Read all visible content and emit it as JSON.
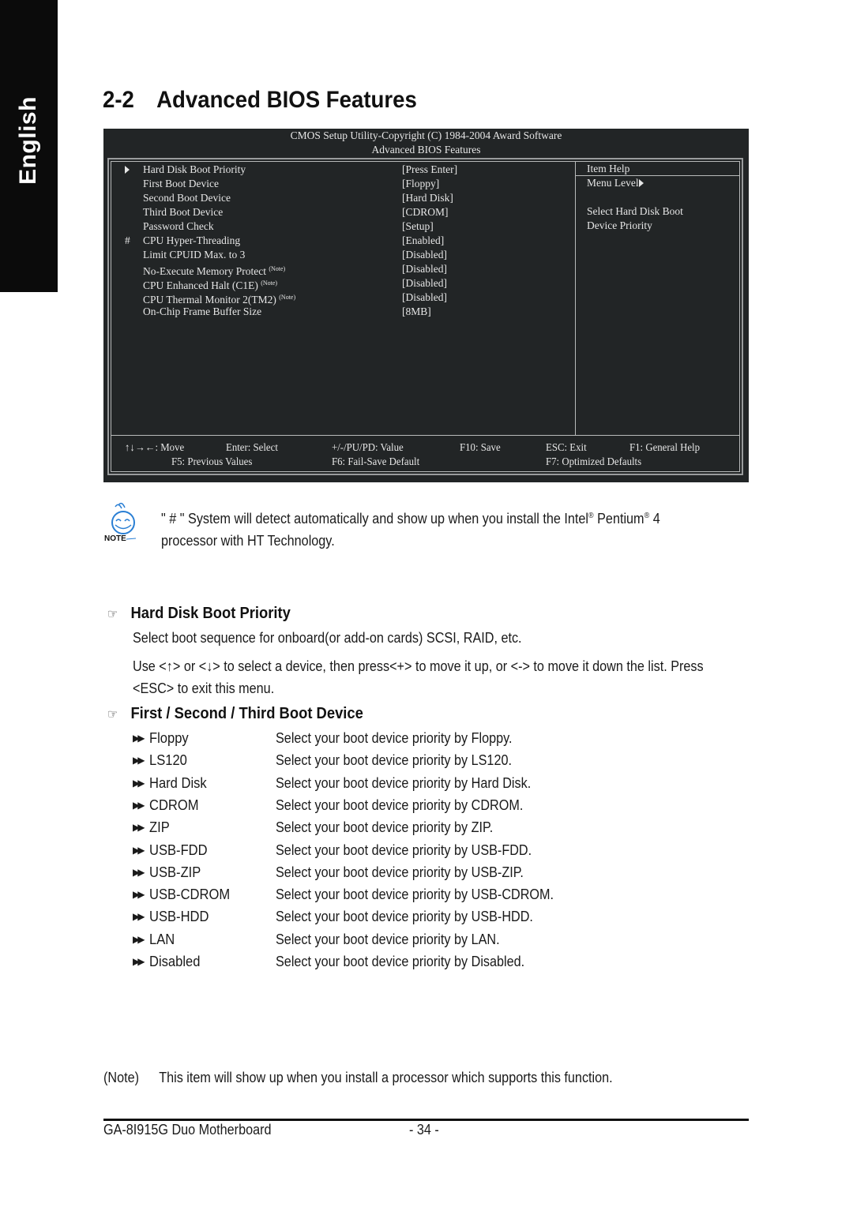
{
  "side_tab": {
    "label": "English"
  },
  "section": {
    "number": "2-2",
    "title": "Advanced BIOS Features"
  },
  "bios": {
    "header_line1": "CMOS Setup Utility-Copyright (C) 1984-2004 Award Software",
    "header_line2": "Advanced BIOS Features",
    "items": [
      {
        "marker": "triangle-right",
        "label": "Hard Disk Boot Priority",
        "note": "",
        "value": "[Press Enter]"
      },
      {
        "marker": "",
        "label": "First Boot Device",
        "note": "",
        "value": "[Floppy]"
      },
      {
        "marker": "",
        "label": "Second Boot Device",
        "note": "",
        "value": "[Hard Disk]"
      },
      {
        "marker": "",
        "label": "Third Boot Device",
        "note": "",
        "value": "[CDROM]"
      },
      {
        "marker": "",
        "label": "Password Check",
        "note": "",
        "value": "[Setup]"
      },
      {
        "marker": "#",
        "label": "CPU Hyper-Threading",
        "note": "",
        "value": "[Enabled]"
      },
      {
        "marker": "",
        "label": "Limit CPUID Max. to 3",
        "note": "",
        "value": "[Disabled]"
      },
      {
        "marker": "",
        "label": "No-Execute Memory Protect",
        "note": "(Note)",
        "value": "[Disabled]"
      },
      {
        "marker": "",
        "label": "CPU Enhanced Halt (C1E)",
        "note": "(Note)",
        "value": "[Disabled]"
      },
      {
        "marker": "",
        "label": "CPU Thermal Monitor 2(TM2)",
        "note": "(Note)",
        "value": "[Disabled]"
      },
      {
        "marker": "",
        "label": "On-Chip Frame Buffer Size",
        "note": "",
        "value": "[8MB]"
      }
    ],
    "help": {
      "title": "Item Help",
      "menu_level": "Menu Level",
      "lines": [
        "Select Hard Disk Boot",
        "Device Priority"
      ]
    },
    "footer": {
      "row1": [
        "↑↓→←: Move",
        "Enter: Select",
        "+/-/PU/PD: Value",
        "F10: Save",
        "ESC: Exit",
        "F1: General Help"
      ],
      "row2": [
        "F5: Previous Values",
        "F6: Fail-Save Default",
        "F7: Optimized Defaults"
      ]
    }
  },
  "note": {
    "icon_label": "NOTE",
    "line1": "\" # \" System will detect automatically and show up when you install the Intel",
    "reg": "®",
    "pentium": " Pentium",
    "line1_end": " 4",
    "line2": "processor with HT Technology."
  },
  "hdd_priority": {
    "heading": "Hard Disk Boot Priority",
    "para1": "Select boot sequence for onboard(or add-on cards) SCSI, RAID, etc.",
    "para2_line1": "Use <↑> or <↓> to select a device, then press<+> to move it up, or <-> to move it down the list. Press",
    "para2_line2": "<ESC> to exit this menu."
  },
  "boot_device": {
    "heading": "First / Second / Third Boot Device",
    "options": [
      {
        "name": "Floppy",
        "desc": "Select your boot device priority by Floppy."
      },
      {
        "name": "LS120",
        "desc": "Select your boot device priority by LS120."
      },
      {
        "name": "Hard Disk",
        "desc": "Select your boot device priority by Hard Disk."
      },
      {
        "name": "CDROM",
        "desc": "Select your boot device priority by CDROM."
      },
      {
        "name": "ZIP",
        "desc": "Select your boot device priority by ZIP."
      },
      {
        "name": "USB-FDD",
        "desc": "Select your boot device priority by USB-FDD."
      },
      {
        "name": "USB-ZIP",
        "desc": "Select your boot device priority by USB-ZIP."
      },
      {
        "name": "USB-CDROM",
        "desc": "Select your boot device priority by USB-CDROM."
      },
      {
        "name": "USB-HDD",
        "desc": "Select your boot device priority by USB-HDD."
      },
      {
        "name": "LAN",
        "desc": "Select your boot device priority by LAN."
      },
      {
        "name": "Disabled",
        "desc": "Select your boot device priority by Disabled."
      }
    ]
  },
  "footnote": {
    "tag": "(Note)",
    "text": "This item will show up when you install a processor which supports this function."
  },
  "page_footer": {
    "product": "GA-8I915G Duo Motherboard",
    "page": "- 34 -"
  },
  "colors": {
    "bios_bg": "#222526",
    "bios_text": "#e6e6e6",
    "side_tab_bg": "#0b0b0b",
    "note_icon_blue": "#2a7fd4"
  }
}
